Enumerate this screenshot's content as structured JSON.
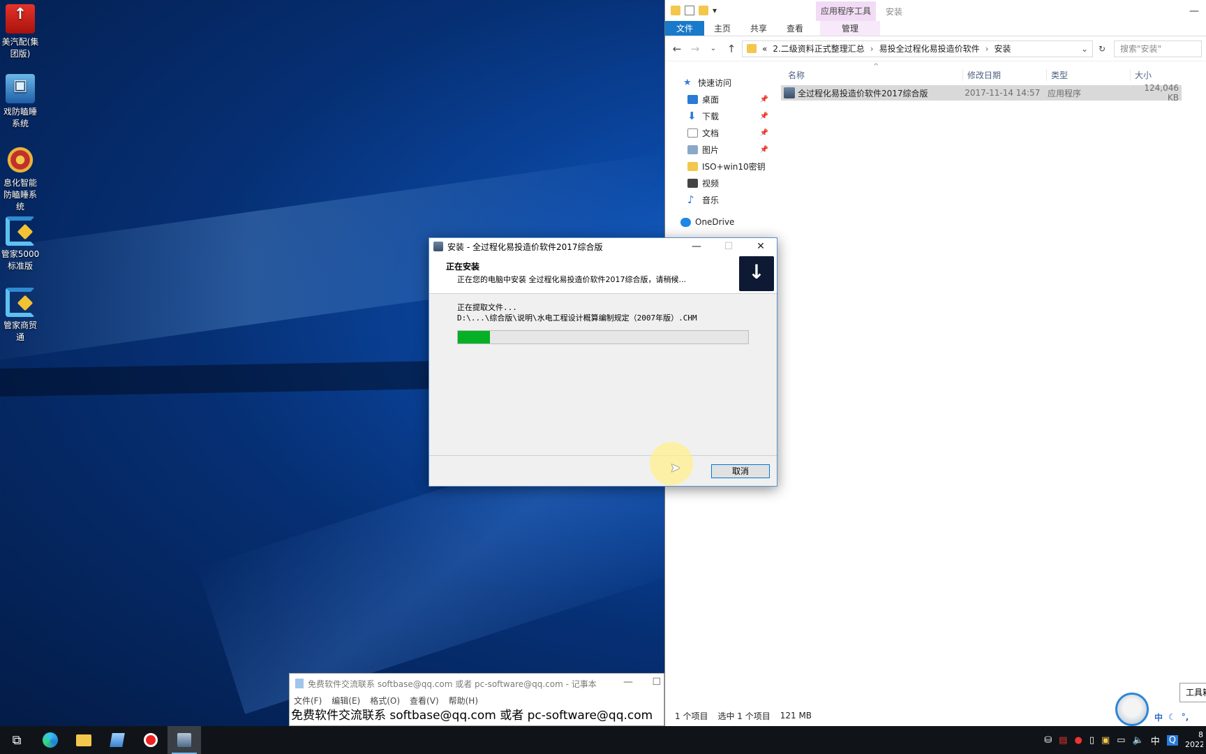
{
  "desktop": {
    "icons": [
      {
        "label": "美汽配(集团版)",
        "icon": "red-company-logo-icon"
      },
      {
        "label": "戏防瞌睡系统",
        "icon": "computer-icon"
      },
      {
        "label": "息化智能防瞌睡系统",
        "icon": "police-badge-icon"
      },
      {
        "label": "管家5000标准版",
        "icon": "swirl-icon"
      },
      {
        "label": "管家商贸通",
        "icon": "swirl-icon"
      }
    ]
  },
  "explorer": {
    "context_tab": "应用程序工具",
    "window_title": "安装",
    "ribbon_tabs": {
      "file": "文件",
      "home": "主页",
      "share": "共享",
      "view": "查看",
      "manage": "管理"
    },
    "address": {
      "overflow": "«",
      "crumbs": [
        "2.二级资料正式整理汇总",
        "易投全过程化易投造价软件",
        "安装"
      ]
    },
    "search_placeholder": "搜索\"安装\"",
    "nav": {
      "quick_access": "快速访问",
      "desktop": "桌面",
      "downloads": "下载",
      "documents": "文档",
      "pictures": "图片",
      "iso": "ISO+win10密钥",
      "videos": "视频",
      "music": "音乐",
      "onedrive": "OneDrive"
    },
    "columns": {
      "name": "名称",
      "date": "修改日期",
      "type": "类型",
      "size": "大小"
    },
    "files": [
      {
        "name": "全过程化易投造价软件2017综合版",
        "date": "2017-11-14 14:57",
        "type": "应用程序",
        "size": "124,046 KB"
      }
    ],
    "status": {
      "count": "1 个项目",
      "selected": "选中 1 个项目",
      "size": "121 MB"
    }
  },
  "installer": {
    "title": "安装 - 全过程化易投造价软件2017综合版",
    "heading": "正在安装",
    "subheading": "正在您的电脑中安装 全过程化易投造价软件2017综合版，请稍候...",
    "status": "正在提取文件...",
    "file": "D:\\...\\综合版\\说明\\水电工程设计概算编制规定（2007年版）.CHM",
    "progress": 0.11,
    "cancel": "取消",
    "progress_color": "#06b025"
  },
  "notepad": {
    "title": "免费软件交流联系 softbase@qq.com 或者 pc-software@qq.com - 记事本",
    "menu": [
      "文件(F)",
      "编辑(E)",
      "格式(O)",
      "查看(V)",
      "帮助(H)"
    ],
    "text": "免费软件交流联系 softbase@qq.com 或者 pc-software@qq.com"
  },
  "floating": {
    "toolbox": "工具箱",
    "ime": "中"
  },
  "taskbar": {
    "apps": [
      "task-view-icon",
      "edge-icon",
      "file-explorer-icon",
      "notepad-icon",
      "record-icon",
      "installer-icon"
    ],
    "tray_ime": "中",
    "clock_time": "8",
    "clock_date": "2022"
  }
}
